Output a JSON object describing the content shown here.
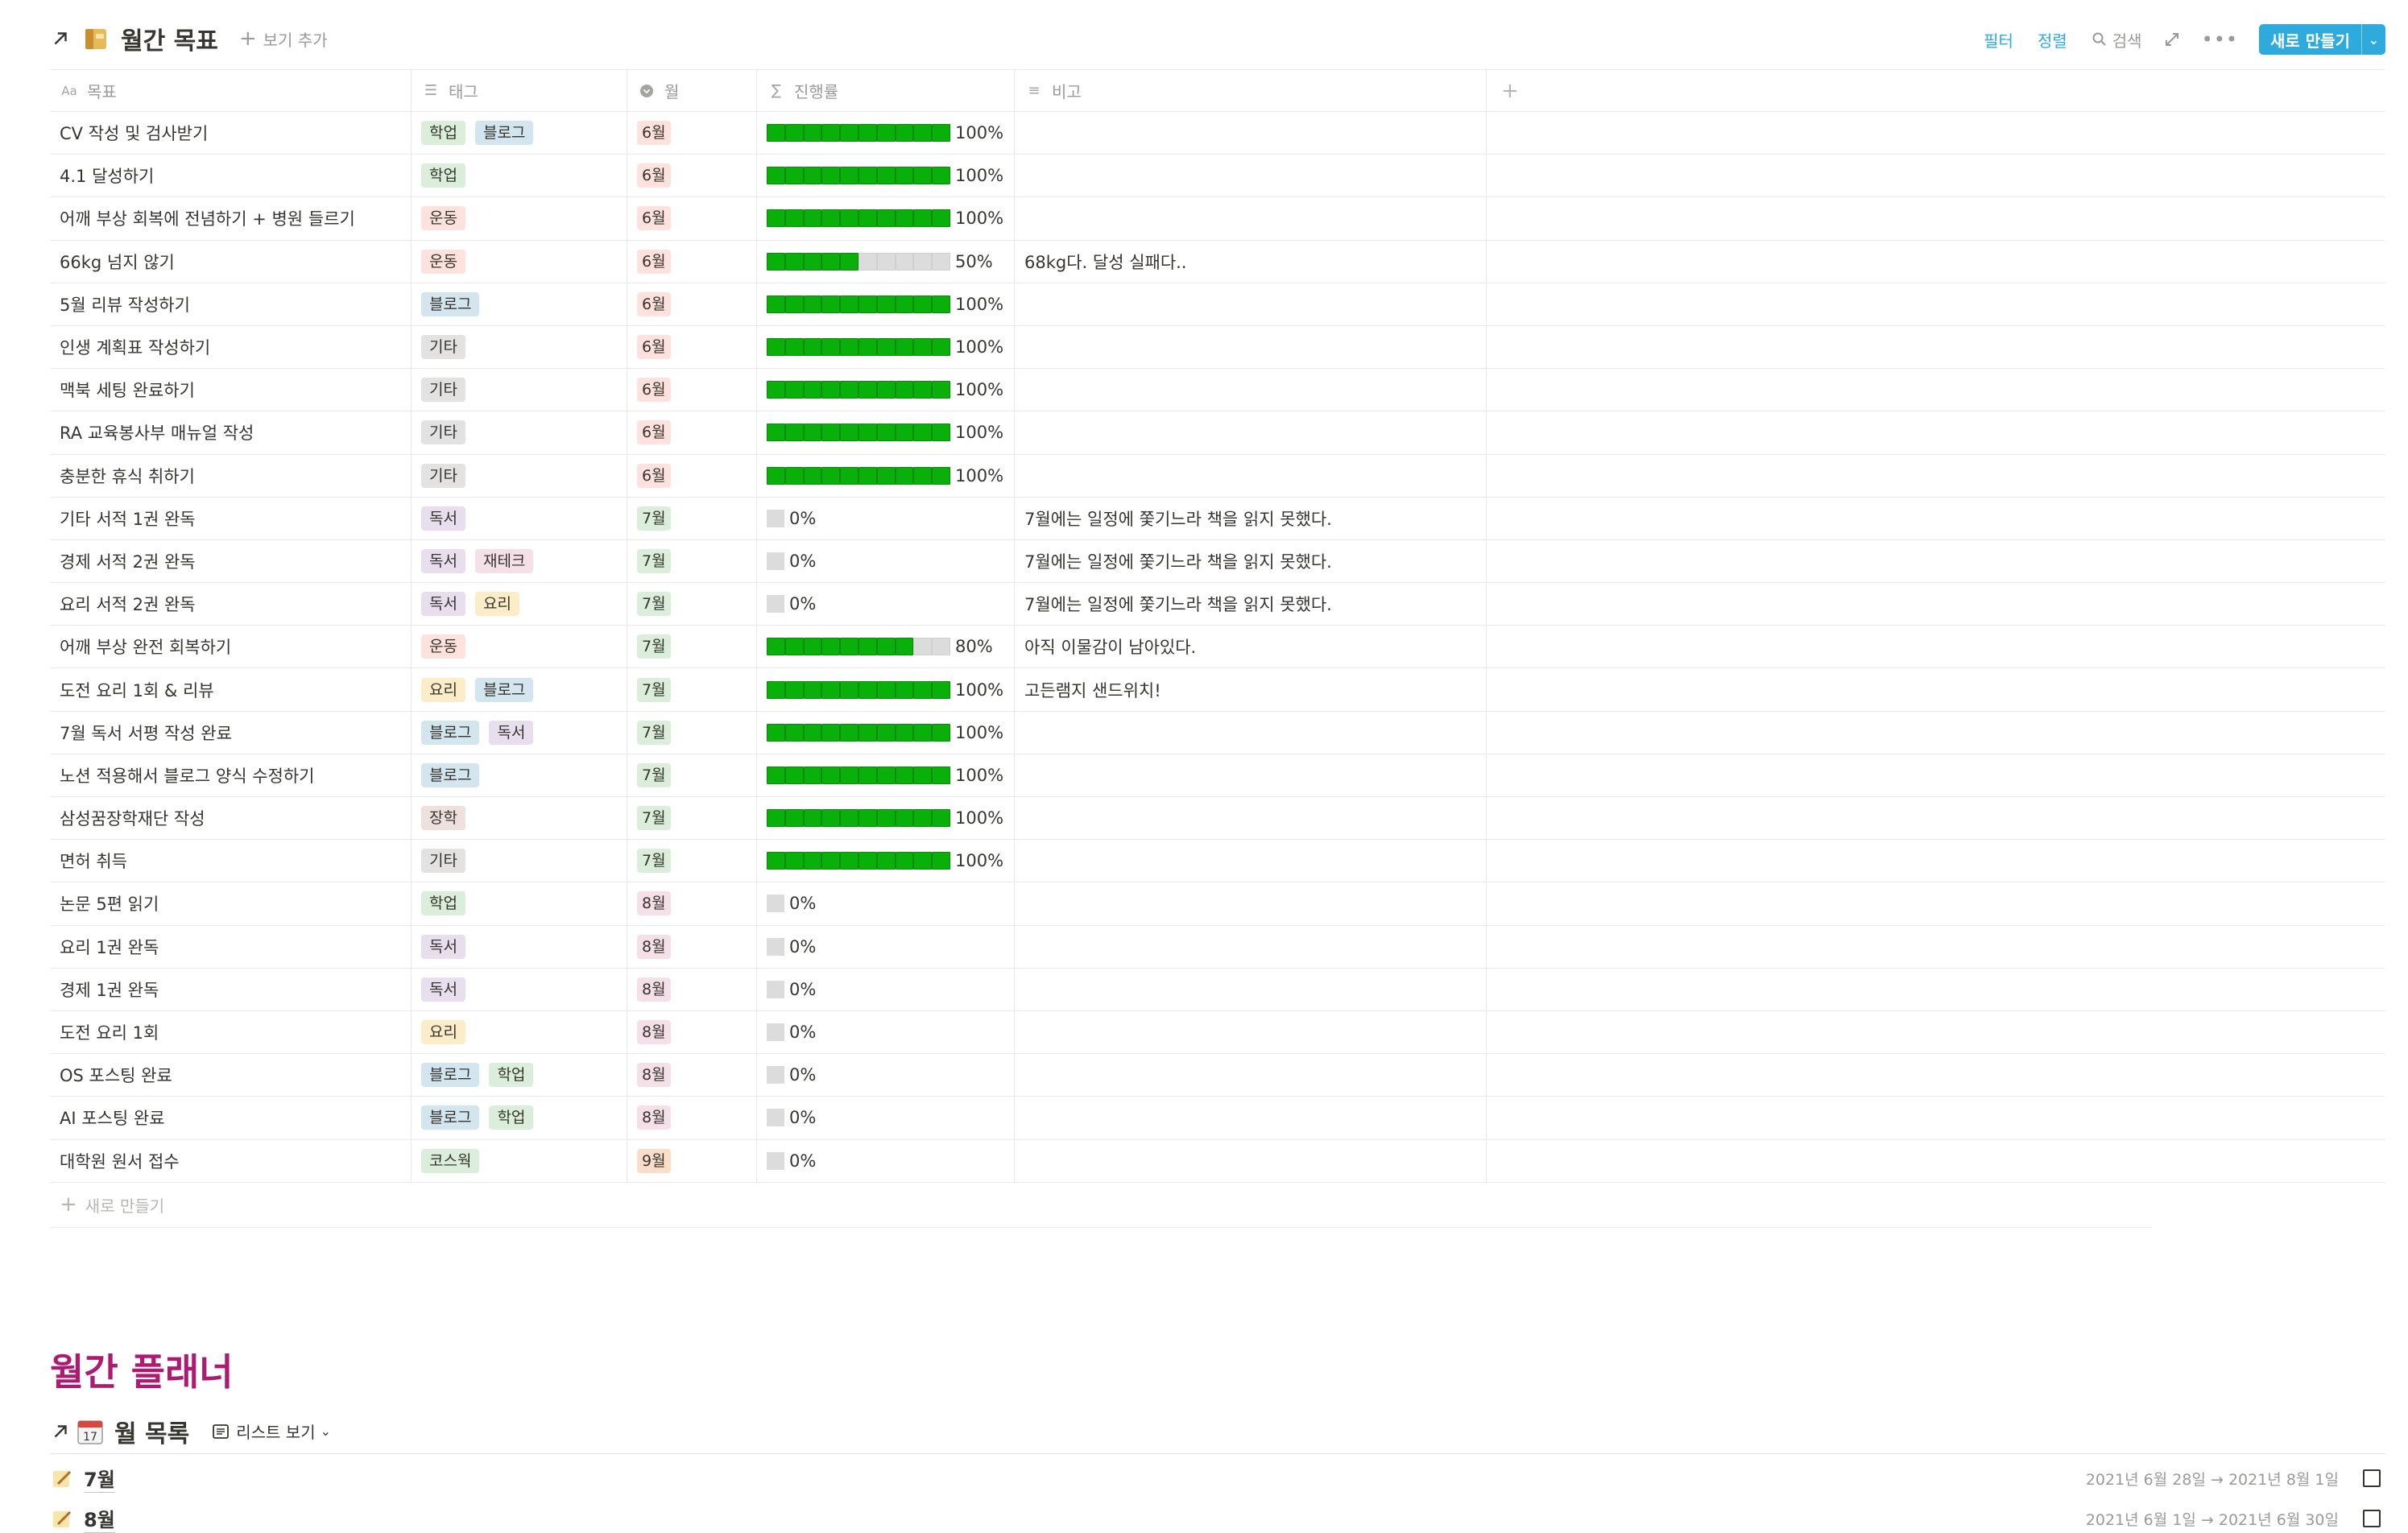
{
  "database": {
    "title": "월간 목표",
    "add_view": "보기 추가",
    "actions": {
      "filter": "필터",
      "sort": "정렬",
      "search": "검색",
      "new": "새로 만들기"
    },
    "columns": [
      {
        "name": "목표",
        "icon": "title-icon"
      },
      {
        "name": "태그",
        "icon": "multi-select-icon"
      },
      {
        "name": "월",
        "icon": "select-icon"
      },
      {
        "name": "진행률",
        "icon": "formula-icon"
      },
      {
        "name": "비고",
        "icon": "text-icon"
      }
    ],
    "rows": [
      {
        "goal": "CV 작성 및 검사받기",
        "tags": [
          "학업",
          "블로그"
        ],
        "month": "6월",
        "progress": 100,
        "note": ""
      },
      {
        "goal": "4.1 달성하기",
        "tags": [
          "학업"
        ],
        "month": "6월",
        "progress": 100,
        "note": ""
      },
      {
        "goal": "어깨 부상 회복에 전념하기 + 병원 들르기",
        "tags": [
          "운동"
        ],
        "month": "6월",
        "progress": 100,
        "note": ""
      },
      {
        "goal": "66kg 넘지 않기",
        "tags": [
          "운동"
        ],
        "month": "6월",
        "progress": 50,
        "note": "68kg다. 달성 실패다.."
      },
      {
        "goal": "5월 리뷰 작성하기",
        "tags": [
          "블로그"
        ],
        "month": "6월",
        "progress": 100,
        "note": ""
      },
      {
        "goal": "인생 계획표 작성하기",
        "tags": [
          "기타"
        ],
        "month": "6월",
        "progress": 100,
        "note": ""
      },
      {
        "goal": "맥북 세팅 완료하기",
        "tags": [
          "기타"
        ],
        "month": "6월",
        "progress": 100,
        "note": ""
      },
      {
        "goal": "RA 교육봉사부 매뉴얼 작성",
        "tags": [
          "기타"
        ],
        "month": "6월",
        "progress": 100,
        "note": ""
      },
      {
        "goal": "충분한 휴식 취하기",
        "tags": [
          "기타"
        ],
        "month": "6월",
        "progress": 100,
        "note": ""
      },
      {
        "goal": "기타 서적 1권 완독",
        "tags": [
          "독서"
        ],
        "month": "7월",
        "progress": 0,
        "note": "7월에는 일정에 쫓기느라 책을 읽지 못했다."
      },
      {
        "goal": "경제 서적 2권 완독",
        "tags": [
          "독서",
          "재테크"
        ],
        "month": "7월",
        "progress": 0,
        "note": "7월에는 일정에 쫓기느라 책을 읽지 못했다."
      },
      {
        "goal": "요리 서적 2권 완독",
        "tags": [
          "독서",
          "요리"
        ],
        "month": "7월",
        "progress": 0,
        "note": "7월에는 일정에 쫓기느라 책을 읽지 못했다."
      },
      {
        "goal": "어깨 부상 완전 회복하기",
        "tags": [
          "운동"
        ],
        "month": "7월",
        "progress": 80,
        "note": "아직 이물감이 남아있다."
      },
      {
        "goal": "도전 요리 1회 & 리뷰",
        "tags": [
          "요리",
          "블로그"
        ],
        "month": "7월",
        "progress": 100,
        "note": "고든램지 샌드위치!"
      },
      {
        "goal": "7월 독서 서평 작성 완료",
        "tags": [
          "블로그",
          "독서"
        ],
        "month": "7월",
        "progress": 100,
        "note": ""
      },
      {
        "goal": "노션 적용해서 블로그 양식 수정하기",
        "tags": [
          "블로그"
        ],
        "month": "7월",
        "progress": 100,
        "note": ""
      },
      {
        "goal": "삼성꿈장학재단 작성",
        "tags": [
          "장학"
        ],
        "month": "7월",
        "progress": 100,
        "note": ""
      },
      {
        "goal": "면허 취득",
        "tags": [
          "기타"
        ],
        "month": "7월",
        "progress": 100,
        "note": ""
      },
      {
        "goal": "논문 5편 읽기",
        "tags": [
          "학업"
        ],
        "month": "8월",
        "progress": 0,
        "note": ""
      },
      {
        "goal": "요리 1권 완독",
        "tags": [
          "독서"
        ],
        "month": "8월",
        "progress": 0,
        "note": ""
      },
      {
        "goal": "경제 1권 완독",
        "tags": [
          "독서"
        ],
        "month": "8월",
        "progress": 0,
        "note": ""
      },
      {
        "goal": "도전 요리 1회",
        "tags": [
          "요리"
        ],
        "month": "8월",
        "progress": 0,
        "note": ""
      },
      {
        "goal": "OS 포스팅 완료",
        "tags": [
          "블로그",
          "학업"
        ],
        "month": "8월",
        "progress": 0,
        "note": ""
      },
      {
        "goal": "AI 포스팅 완료",
        "tags": [
          "블로그",
          "학업"
        ],
        "month": "8월",
        "progress": 0,
        "note": ""
      },
      {
        "goal": "대학원 원서 접수",
        "tags": [
          "코스웍"
        ],
        "month": "9월",
        "progress": 0,
        "note": ""
      }
    ],
    "new_row": "새로 만들기",
    "tag_colors": {
      "학업": "#dbeddb",
      "블로그": "#d3e5ef",
      "운동": "#ffe2dd",
      "기타": "#e3e2e0",
      "독서": "#e8deee",
      "재테크": "#f5e0e9",
      "요리": "#fdecc8",
      "장학": "#eee0da",
      "코스웍": "#dbeddb"
    },
    "month_colors": {
      "6월": "#ffe2dd",
      "7월": "#dbeddb",
      "8월": "#f5e0e9",
      "9월": "#fadec9"
    },
    "progress_bar_color": "#0ab00a"
  },
  "planner": {
    "heading": "월간 플래너",
    "heading_color": "#ad1a72",
    "list_title": "월 목록",
    "view_label": "리스트 보기",
    "items": [
      {
        "title": "7월",
        "date": "2021년 6월 28일 → 2021년 8월 1일"
      },
      {
        "title": "8월",
        "date": "2021년 6월 1일 → 2021년 6월 30일"
      }
    ]
  }
}
